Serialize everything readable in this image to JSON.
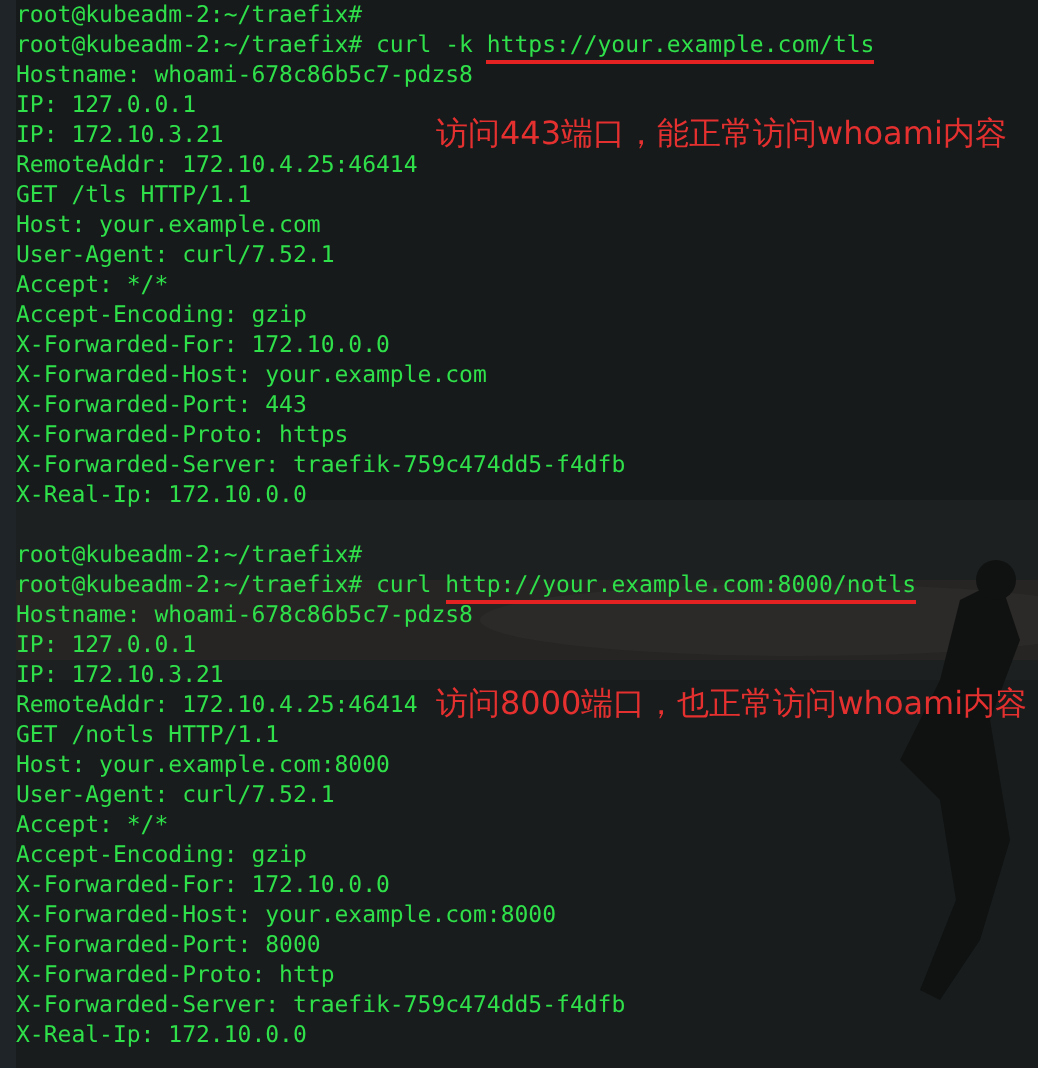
{
  "terminal": {
    "lines": [
      {
        "kind": "prompt",
        "prompt": "root@kubeadm-2:~/traefix#"
      },
      {
        "kind": "prompt",
        "prompt": "root@kubeadm-2:~/traefix#",
        "command": "curl -k",
        "url": {
          "text": "https://your.example.com/tls",
          "underlined": true
        }
      },
      {
        "kind": "output",
        "text": "Hostname: whoami-678c86b5c7-pdzs8"
      },
      {
        "kind": "output",
        "text": "IP: 127.0.0.1"
      },
      {
        "kind": "output",
        "text": "IP: 172.10.3.21",
        "note": "访问443端口，能正常访问whoami内容"
      },
      {
        "kind": "output",
        "text": "RemoteAddr: 172.10.4.25:46414"
      },
      {
        "kind": "output",
        "text": "GET /tls HTTP/1.1"
      },
      {
        "kind": "output",
        "text": "Host: your.example.com"
      },
      {
        "kind": "output",
        "text": "User-Agent: curl/7.52.1"
      },
      {
        "kind": "output",
        "text": "Accept: */*"
      },
      {
        "kind": "output",
        "text": "Accept-Encoding: gzip"
      },
      {
        "kind": "output",
        "text": "X-Forwarded-For: 172.10.0.0"
      },
      {
        "kind": "output",
        "text": "X-Forwarded-Host: your.example.com"
      },
      {
        "kind": "output",
        "text": "X-Forwarded-Port: 443"
      },
      {
        "kind": "output",
        "text": "X-Forwarded-Proto: https"
      },
      {
        "kind": "output",
        "text": "X-Forwarded-Server: traefik-759c474dd5-f4dfb"
      },
      {
        "kind": "output",
        "text": "X-Real-Ip: 172.10.0.0"
      },
      {
        "kind": "blank"
      },
      {
        "kind": "prompt",
        "prompt": "root@kubeadm-2:~/traefix#"
      },
      {
        "kind": "prompt",
        "prompt": "root@kubeadm-2:~/traefix#",
        "command": "curl",
        "url": {
          "text": "http://your.example.com:8000/notls",
          "underlined": true
        }
      },
      {
        "kind": "output",
        "text": "Hostname: whoami-678c86b5c7-pdzs8"
      },
      {
        "kind": "output",
        "text": "IP: 127.0.0.1"
      },
      {
        "kind": "output",
        "text": "IP: 172.10.3.21"
      },
      {
        "kind": "output",
        "text": "RemoteAddr: 172.10.4.25:46414",
        "note": "访问8000端口，也正常访问whoami内容"
      },
      {
        "kind": "output",
        "text": "GET /notls HTTP/1.1"
      },
      {
        "kind": "output",
        "text": "Host: your.example.com:8000"
      },
      {
        "kind": "output",
        "text": "User-Agent: curl/7.52.1"
      },
      {
        "kind": "output",
        "text": "Accept: */*"
      },
      {
        "kind": "output",
        "text": "Accept-Encoding: gzip"
      },
      {
        "kind": "output",
        "text": "X-Forwarded-For: 172.10.0.0"
      },
      {
        "kind": "output",
        "text": "X-Forwarded-Host: your.example.com:8000"
      },
      {
        "kind": "output",
        "text": "X-Forwarded-Port: 8000"
      },
      {
        "kind": "output",
        "text": "X-Forwarded-Proto: http"
      },
      {
        "kind": "output",
        "text": "X-Forwarded-Server: traefik-759c474dd5-f4dfb"
      },
      {
        "kind": "output",
        "text": "X-Real-Ip: 172.10.0.0"
      }
    ]
  }
}
